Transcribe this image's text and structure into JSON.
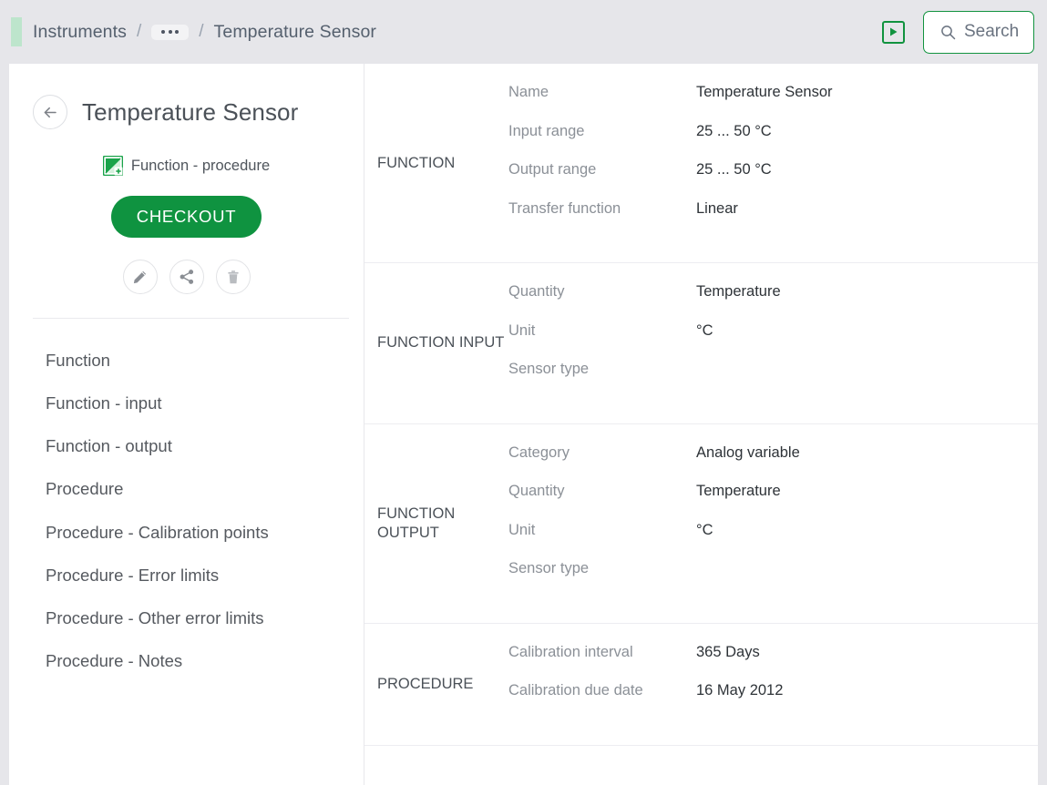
{
  "topbar": {
    "breadcrumb": {
      "root": "Instruments",
      "separator": "/",
      "ellipsis": "…",
      "current": "Temperature Sensor"
    },
    "play_button_icon": "play-icon",
    "search": {
      "placeholder": "Search",
      "icon": "search-icon"
    },
    "accent_color": "#bde5cc",
    "background_color": "#e6e6ea"
  },
  "left_panel": {
    "back_icon": "arrow-left-icon",
    "title": "Temperature Sensor",
    "type_icon": "function-procedure-icon",
    "type_label": "Function - procedure",
    "checkout_label": "CHECKOUT",
    "checkout_color": "#0f9340",
    "actions": [
      {
        "name": "edit",
        "icon": "pencil-icon"
      },
      {
        "name": "share",
        "icon": "share-icon"
      },
      {
        "name": "delete",
        "icon": "trash-icon"
      }
    ],
    "nav_items": [
      {
        "label": "Function"
      },
      {
        "label": "Function - input"
      },
      {
        "label": "Function - output"
      },
      {
        "label": "Procedure"
      },
      {
        "label": "Procedure - Calibration points"
      },
      {
        "label": "Procedure - Error limits"
      },
      {
        "label": "Procedure - Other error limits"
      },
      {
        "label": "Procedure - Notes"
      }
    ]
  },
  "details": {
    "sections": [
      {
        "label": "FUNCTION",
        "rows": [
          {
            "label": "Name",
            "value": "Temperature Sensor"
          },
          {
            "label": "Input range",
            "value": "25 ... 50 °C"
          },
          {
            "label": "Output range",
            "value": "25 ... 50 °C"
          },
          {
            "label": "Transfer function",
            "value": "Linear"
          }
        ]
      },
      {
        "label": "FUNCTION INPUT",
        "rows": [
          {
            "label": "Quantity",
            "value": "Temperature"
          },
          {
            "label": "Unit",
            "value": "°C"
          },
          {
            "label": "Sensor type",
            "value": ""
          }
        ]
      },
      {
        "label": "FUNCTION OUTPUT",
        "rows": [
          {
            "label": "Category",
            "value": "Analog variable"
          },
          {
            "label": "Quantity",
            "value": "Temperature"
          },
          {
            "label": "Unit",
            "value": "°C"
          },
          {
            "label": "Sensor type",
            "value": ""
          }
        ]
      },
      {
        "label": "PROCEDURE",
        "rows": [
          {
            "label": "Calibration interval",
            "value": "365 Days"
          },
          {
            "label": "Calibration due date",
            "value": "16 May 2012"
          }
        ]
      }
    ]
  }
}
